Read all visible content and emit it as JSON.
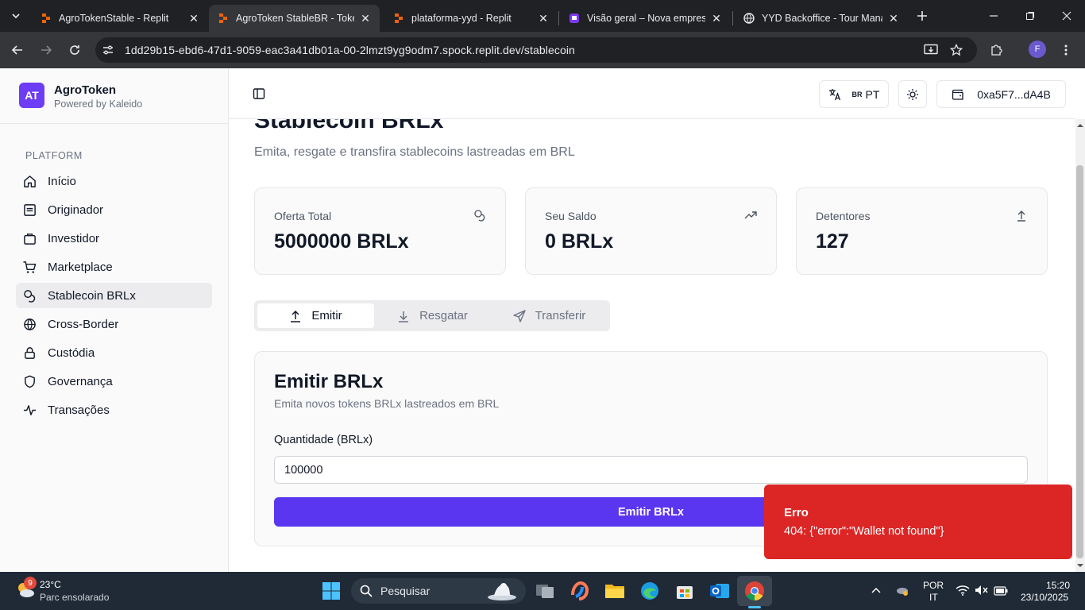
{
  "browser": {
    "tabs": [
      {
        "title": "AgroTokenStable - Replit",
        "active": false
      },
      {
        "title": "AgroToken StableBR - Token",
        "active": true
      },
      {
        "title": "plataforma-yyd - Replit",
        "active": false
      },
      {
        "title": "Visão geral – Nova empresa",
        "active": false
      },
      {
        "title": "YYD Backoffice - Tour Manag",
        "active": false
      }
    ],
    "url": "1dd29b15-ebd6-47d1-9059-eac3a41db01a-00-2lmzt9yg9odm7.spock.replit.dev/stablecoin",
    "profile_initial": "F"
  },
  "app": {
    "logo": "AT",
    "brand": "AgroToken",
    "brand_sub": "Powered by Kaleido",
    "section_label": "PLATFORM",
    "nav": [
      {
        "label": "Início",
        "icon": "home-icon"
      },
      {
        "label": "Originador",
        "icon": "clipboard-icon"
      },
      {
        "label": "Investidor",
        "icon": "briefcase-icon"
      },
      {
        "label": "Marketplace",
        "icon": "cart-icon"
      },
      {
        "label": "Stablecoin BRLx",
        "icon": "coins-icon",
        "active": true
      },
      {
        "label": "Cross-Border",
        "icon": "globe-icon"
      },
      {
        "label": "Custódia",
        "icon": "lock-icon"
      },
      {
        "label": "Governança",
        "icon": "shield-icon"
      },
      {
        "label": "Transações",
        "icon": "activity-icon"
      }
    ]
  },
  "header": {
    "lang_flag": "BR",
    "lang_code": "PT",
    "wallet": "0xa5F7...dA4B"
  },
  "page": {
    "title": "Stablecoin BRLx",
    "subtitle": "Emita, resgate e transfira stablecoins lastreadas em BRL",
    "cards": [
      {
        "label": "Oferta Total",
        "value": "5000000 BRLx",
        "icon": "coins-icon"
      },
      {
        "label": "Seu Saldo",
        "value": "0 BRLx",
        "icon": "trending-up-icon"
      },
      {
        "label": "Detentores",
        "value": "127",
        "icon": "arrow-up-icon"
      }
    ],
    "tabs": [
      {
        "label": "Emitir",
        "active": true
      },
      {
        "label": "Resgatar"
      },
      {
        "label": "Transferir"
      }
    ],
    "form": {
      "title": "Emitir BRLx",
      "subtitle": "Emita novos tokens BRLx lastreados em BRL",
      "field_label": "Quantidade (BRLx)",
      "field_value": "100000",
      "submit_label": "Emitir BRLx"
    }
  },
  "toast": {
    "title": "Erro",
    "message": "404: {\"error\":\"Wallet not found\"}"
  },
  "taskbar": {
    "weather_badge": "9",
    "temperature": "23°C",
    "weather_desc": "Parc ensolarado",
    "search_placeholder": "Pesquisar",
    "lang_line1": "POR",
    "lang_line2": "IT",
    "time": "15:20",
    "date": "23/10/2025"
  },
  "colors": {
    "accent": "#5b36f0",
    "error": "#dc2626",
    "logo": "#6d3cf5"
  }
}
